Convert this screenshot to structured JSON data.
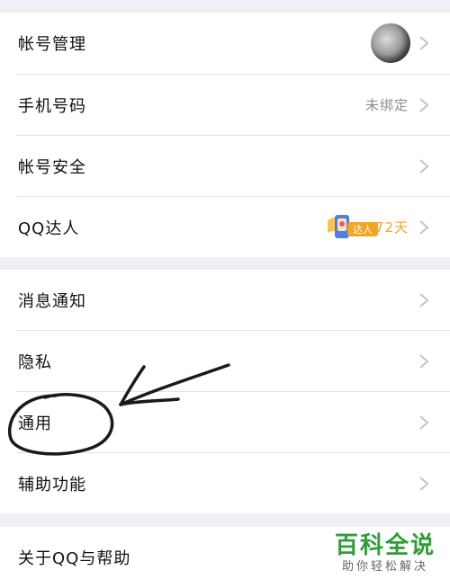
{
  "settings": {
    "group1": [
      {
        "label": "帐号管理"
      },
      {
        "label": "手机号码",
        "value": "未绑定"
      },
      {
        "label": "帐号安全"
      },
      {
        "label": "QQ达人",
        "badge_text": "达人",
        "days": "72天"
      }
    ],
    "group2": [
      {
        "label": "消息通知"
      },
      {
        "label": "隐私"
      },
      {
        "label": "通用"
      },
      {
        "label": "辅助功能"
      }
    ],
    "group3": [
      {
        "label": "关于QQ与帮助"
      }
    ]
  },
  "watermark": {
    "title": "百科全说",
    "subtitle": "助你轻松解决"
  },
  "colors": {
    "background": "#efeff4",
    "badge_orange": "#f2a623",
    "watermark_green": "#2f9e3a"
  }
}
